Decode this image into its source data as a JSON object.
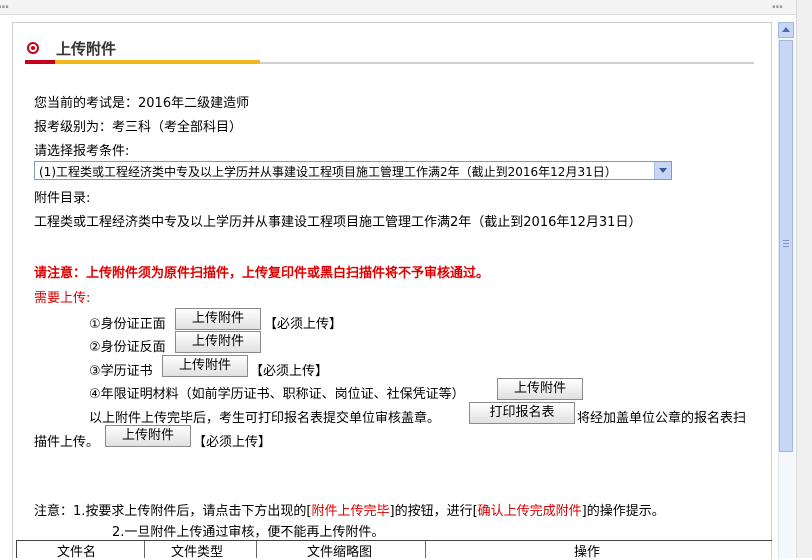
{
  "header": {
    "title": "上传附件"
  },
  "info": {
    "exam": "您当前的考试是：2016年二级建造师",
    "level": "报考级别为：考三科（考全部科目）",
    "select_label": "请选择报考条件:",
    "select_value": "(1)工程类或工程经济类中专及以上学历并从事建设工程项目施工管理工作满2年（截止到2016年12月31日）",
    "attach_dir_label": "附件目录:",
    "attach_dir_text": "工程类或工程经济类中专及以上学历并从事建设工程项目施工管理工作满2年（截止到2016年12月31日）"
  },
  "warning": "请注意：上传附件须为原件扫描件，上传复印件或黑白扫描件将不予审核通过。",
  "need_upload_label": "需要上传:",
  "items": [
    {
      "label": "①身份证正面",
      "button": "上传附件",
      "suffix": "【必须上传】"
    },
    {
      "label": "②身份证反面",
      "button": "上传附件",
      "suffix": ""
    },
    {
      "label": "③学历证书",
      "button": "上传附件",
      "suffix": "【必须上传】"
    },
    {
      "label": "④年限证明材料（如前学历证书、职称证、岗位证、社保凭证等）",
      "button": "上传附件",
      "suffix": ""
    }
  ],
  "print": {
    "text_before": "以上附件上传完毕后，考生可打印报名表提交单位审核盖章。",
    "button": "打印报名表",
    "text_after": "将经加盖单位公章的报名表扫",
    "text_line2": "描件上传。",
    "upload_button": "上传附件",
    "suffix": "【必须上传】"
  },
  "notes": {
    "prefix": "注意：1.按要求上传附件后，请点击下方出现的[",
    "link1": "附件上传完毕",
    "mid": "]的按钮，进行[",
    "link2": "确认上传完成附件",
    "suffix": "]的操作提示。",
    "line2": "2.一旦附件上传通过审核，便不能再上传附件。"
  },
  "table": {
    "columns": [
      "文件名",
      "文件类型",
      "文件缩略图",
      "操作"
    ]
  },
  "colors": {
    "accent_red": "#c4001a",
    "accent_yellow": "#f2b81a",
    "warning_red": "#e00000"
  }
}
